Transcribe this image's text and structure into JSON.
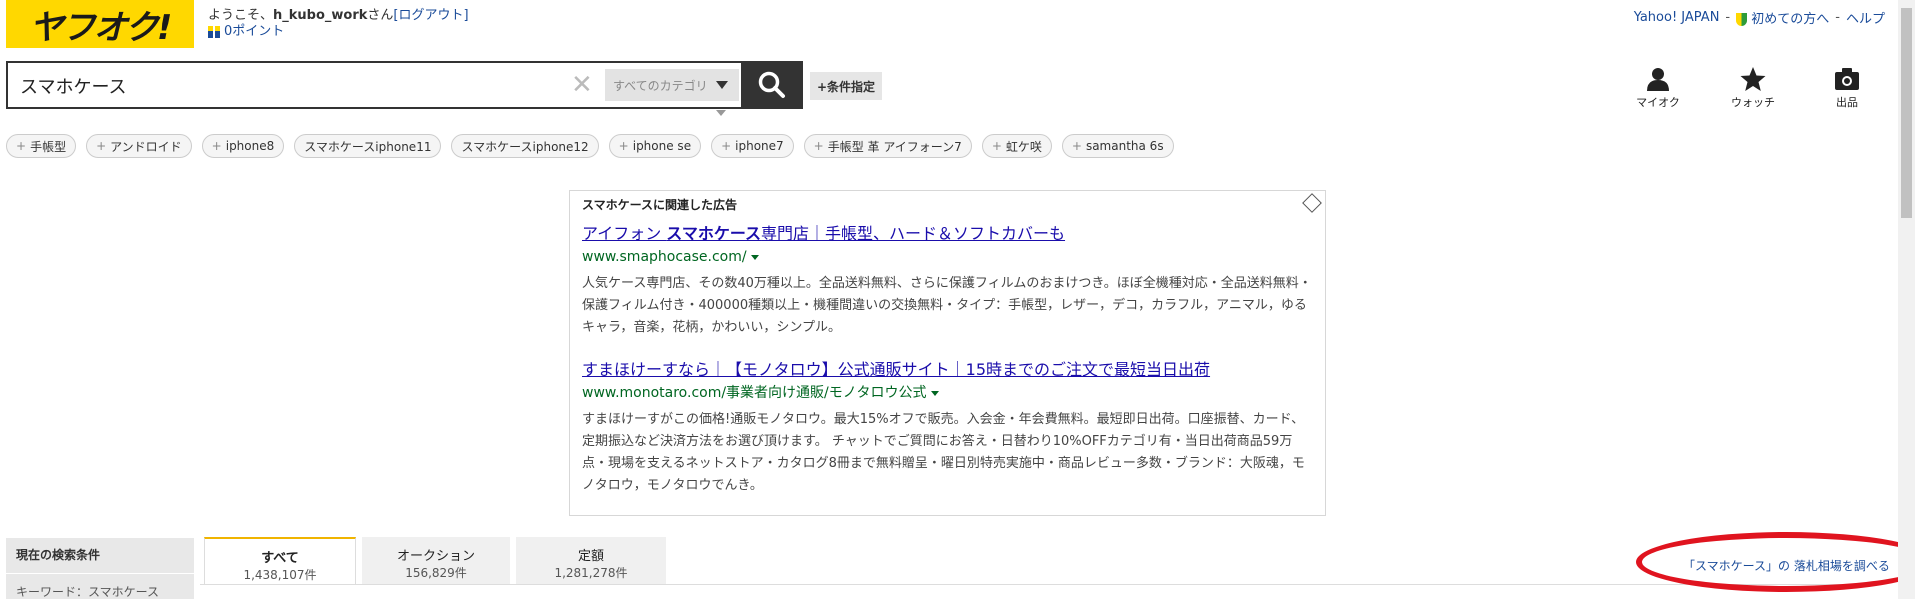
{
  "header": {
    "logo_text": "ヤフオク!",
    "welcome_prefix": "ようこそ、",
    "username": "h_kubo_work",
    "welcome_suffix": "さん",
    "logout": "[ログアウト]",
    "points": "0ポイント",
    "links": {
      "yahoo": "Yahoo! JAPAN",
      "first_time": "初めての方へ",
      "help": "ヘルプ"
    }
  },
  "search": {
    "query": "スマホケース",
    "category": "すべてのカテゴリ",
    "conditions_button": "+条件指定"
  },
  "nav_icons": [
    {
      "label": "マイオク",
      "icon": "person-icon"
    },
    {
      "label": "ウォッチ",
      "icon": "star-icon"
    },
    {
      "label": "出品",
      "icon": "camera-icon"
    }
  ],
  "chips": [
    {
      "label": "手帳型",
      "plus": true
    },
    {
      "label": "アンドロイド",
      "plus": true
    },
    {
      "label": "iphone8",
      "plus": true
    },
    {
      "label": "スマホケースiphone11",
      "plus": false
    },
    {
      "label": "スマホケースiphone12",
      "plus": false
    },
    {
      "label": "iphone se",
      "plus": true
    },
    {
      "label": "iphone7",
      "plus": true
    },
    {
      "label": "手帳型 革 アイフォーン7",
      "plus": true
    },
    {
      "label": "虹ケ咲",
      "plus": true
    },
    {
      "label": "samantha 6s",
      "plus": true
    }
  ],
  "ads": {
    "heading": "スマホケースに関連した広告",
    "items": [
      {
        "title_pre": "アイフォン ",
        "title_bold": "スマホケース",
        "title_post": "専門店｜手帳型、ハード＆ソフトカバーも",
        "url": "www.smaphocase.com/",
        "desc": "人気ケース専門店、その数40万種以上。全品送料無料、さらに保護フィルムのおまけつき。ほぼ全機種対応・全品送料無料・保護フィルム付き・400000種類以上・機種間違いの交換無料・タイプ：手帳型，レザー，デコ，カラフル，アニマル，ゆるキャラ，音楽，花柄，かわいい，シンプル。"
      },
      {
        "title_pre": "すまほけーすなら｜【モノタロウ】公式通販サイト｜15時までのご注文で最短当日出荷",
        "title_bold": "",
        "title_post": "",
        "url": "www.monotaro.com/事業者向け通販/モノタロウ公式",
        "desc": "すまほけーすがこの価格!通販モノタロウ。最大15%オフで販売。入会金・年会費無料。最短即日出荷。口座振替、カード、定期振込など決済方法をお選び頂けます。 チャットでご質問にお答え・日替わり10%OFFカテゴリ有・当日出荷商品59万点・現場を支えるネットストア・カタログ8冊まで無料贈呈・曜日別特売実施中・商品レビュー多数・ブランド：大阪魂，モノタロウ，モノタロウでんき。"
      }
    ]
  },
  "conditions": {
    "title": "現在の検索条件",
    "keyword": "キーワード：スマホケース"
  },
  "tabs": [
    {
      "label": "すべて",
      "count": "1,438,107件",
      "active": true
    },
    {
      "label": "オークション",
      "count": "156,829件",
      "active": false
    },
    {
      "label": "定額",
      "count": "1,281,278件",
      "active": false
    }
  ],
  "market_link": "「スマホケース」の 落札相場を調べる",
  "colors": {
    "brand_yellow": "#ffd800",
    "link_blue": "#1a4b99",
    "ad_title": "#1a0dab",
    "ad_url": "#006621",
    "highlight_red": "#e0141f"
  }
}
